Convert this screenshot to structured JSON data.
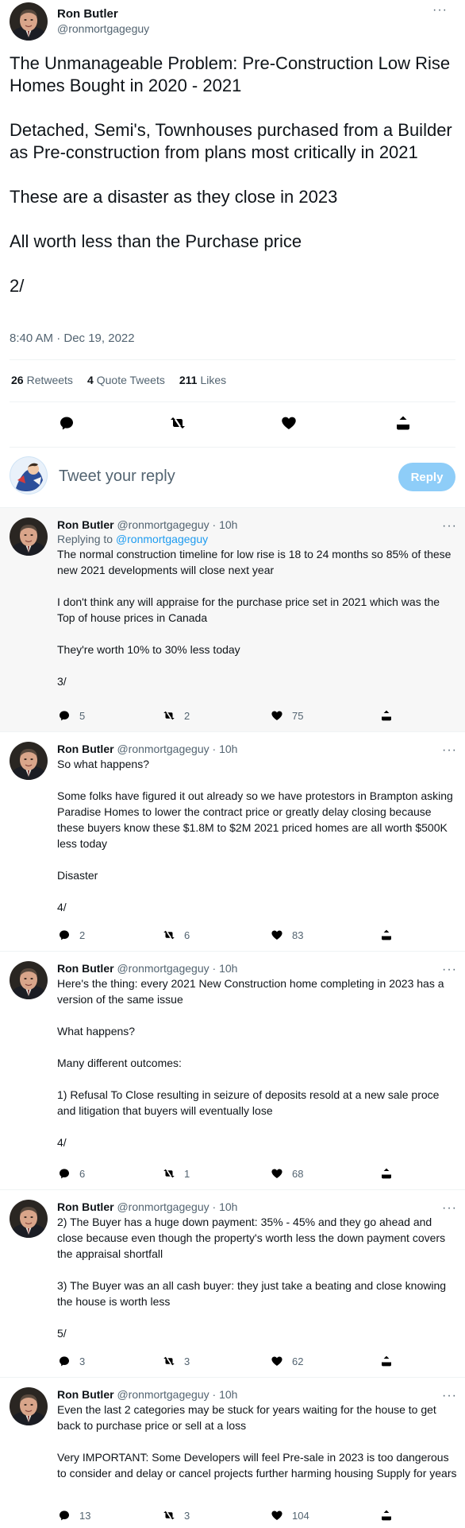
{
  "main_tweet": {
    "name": "Ron Butler",
    "handle": "@ronmortgageguy",
    "text": [
      "The Unmanageable Problem: Pre-Construction Low Rise Homes Bought in 2020 - 2021",
      "Detached, Semi's, Townhouses purchased from a Builder as Pre-construction from plans most critically in 2021",
      "These are a disaster as they close in 2023",
      "All worth less than the Purchase price",
      "2/"
    ],
    "timestamp": "8:40 AM · Dec 19, 2022",
    "stats": {
      "retweets_count": "26",
      "retweets_label": "Retweets",
      "quotes_count": "4",
      "quotes_label": "Quote Tweets",
      "likes_count": "211",
      "likes_label": "Likes"
    },
    "more_label": "···"
  },
  "reply_box": {
    "placeholder": "Tweet your reply",
    "button_label": "Reply"
  },
  "replies": [
    {
      "name": "Ron Butler",
      "handle": "@ronmortgageguy",
      "time": "· 10h",
      "replying_prefix": "Replying to",
      "replying_to": "@ronmortgageguy",
      "paragraphs": [
        "The normal construction timeline for low rise is 18 to 24 months so 85% of these new 2021 developments will close next year",
        "I don't think any will appraise for the purchase price set in 2021 which was the Top of house prices in Canada",
        "They're worth 10% to 30% less today",
        "3/"
      ],
      "replies": "5",
      "retweets": "2",
      "likes": "75"
    },
    {
      "name": "Ron Butler",
      "handle": "@ronmortgageguy",
      "time": "· 10h",
      "paragraphs": [
        "So what happens?",
        "Some folks have figured it out already so we have protestors in Brampton asking Paradise Homes to lower the contract price or greatly delay closing because these buyers know these $1.8M to $2M 2021 priced  homes are all worth $500K less today",
        "Disaster",
        "4/"
      ],
      "replies": "2",
      "retweets": "6",
      "likes": "83"
    },
    {
      "name": "Ron Butler",
      "handle": "@ronmortgageguy",
      "time": "· 10h",
      "paragraphs": [
        "Here's the thing: every 2021 New Construction home completing in 2023 has a version of the same issue",
        "What happens?",
        "Many different outcomes:",
        "1) Refusal To Close resulting in seizure of deposits resold at a new sale proce and litigation that buyers will eventually lose",
        "4/"
      ],
      "replies": "6",
      "retweets": "1",
      "likes": "68"
    },
    {
      "name": "Ron Butler",
      "handle": "@ronmortgageguy",
      "time": "· 10h",
      "paragraphs": [
        "2) The Buyer has a huge down payment: 35% - 45% and they go ahead and close because even though the property's worth less the down payment covers the appraisal shortfall",
        "3) The Buyer was an all cash buyer: they just take a beating and close knowing the house is worth less",
        "5/"
      ],
      "replies": "3",
      "retweets": "3",
      "likes": "62"
    },
    {
      "name": "Ron Butler",
      "handle": "@ronmortgageguy",
      "time": "· 10h",
      "paragraphs": [
        "Even the last 2 categories may be stuck for years waiting for the house to get back to purchase price or sell at a loss",
        "Very IMPORTANT: Some Developers will feel Pre-sale in 2023 is too dangerous to consider and delay or cancel projects further harming housing Supply for years"
      ],
      "replies": "13",
      "retweets": "3",
      "likes": "104"
    }
  ],
  "colors": {
    "accent": "#1d9bf0",
    "reply_button": "#8ecdf8",
    "secondary_text": "#536471",
    "highlight_bg": "#f7f7f7"
  },
  "icons": {
    "reply": "reply-icon",
    "retweet": "retweet-icon",
    "like": "like-icon",
    "share": "share-icon",
    "more": "more-icon"
  }
}
